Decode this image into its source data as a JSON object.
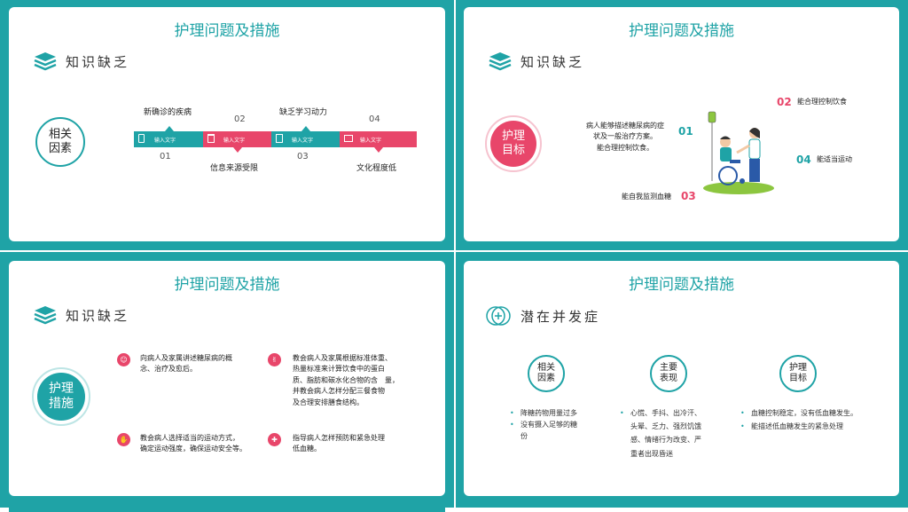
{
  "slide1": {
    "title": "护理问题及措施",
    "subtitle": "知识缺乏",
    "circle_label": "相关\n因素",
    "top_labels": [
      "新确诊的疾病",
      "02",
      "缺乏学习动力",
      "04"
    ],
    "bottom_labels": [
      "01",
      "信息来源受限",
      "03",
      "文化程度低"
    ],
    "segment_text": [
      "输入文字",
      "输入文字",
      "输入文字",
      "输入文字"
    ]
  },
  "slide2": {
    "title": "护理问题及措施",
    "subtitle": "知识缺乏",
    "circle_label": "护理\n目标",
    "goal1_text": "病人能够描述糖尿病的症\n状及一般治疗方案。\n能合理控制饮食。",
    "goal1_num": "01",
    "goal2_num": "02",
    "goal2_text": "能合理控制饮食",
    "goal3_text": "能自我监测血糖",
    "goal3_num": "03",
    "goal4_num": "04",
    "goal4_text": "能适当运动"
  },
  "slide3": {
    "title": "护理问题及措施",
    "subtitle": "知识缺乏",
    "circle_label": "护理\n措施",
    "item1": "向病人及家属讲述糖尿病的概\n念、治疗及愈后。",
    "item2": "教会病人及家属根据标准体重、\n热量标准来计算饮食中的蛋白\n质、脂肪和碳水化合物的含　量，\n并教会病人怎样分配三餐食物\n及合理安排膳食结构。",
    "item3": "教会病人选择适当的运动方式，\n确定运动强度，确保运动安全等。",
    "item4": "指导病人怎样预防和紧急处理\n低血糖。"
  },
  "slide4": {
    "title": "护理问题及措施",
    "subtitle": "潜在并发症",
    "col1_title": "相关\n因素",
    "col1_items": [
      "降糖药物用量过多",
      "没有摄入足够的糖\n份"
    ],
    "col2_title": "主要\n表现",
    "col2_items": [
      "心慌、手抖、出冷汗、\n头晕、乏力、强烈饥饿\n感、情绪行为改变、严\n重者出现昏迷"
    ],
    "col3_title": "护理\n目标",
    "col3_items": [
      "血糖控制稳定，没有低血糖发生。",
      "能描述低血糖发生的紧急处理"
    ]
  },
  "colors": {
    "teal": "#1fa3a6",
    "pink": "#e8466a"
  }
}
